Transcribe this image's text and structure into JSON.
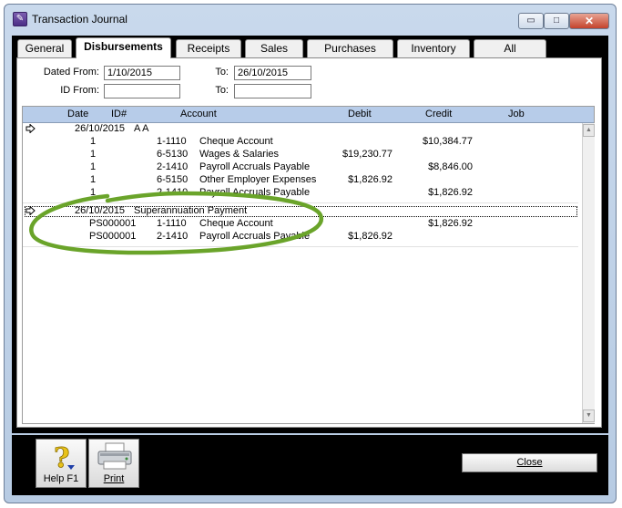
{
  "window": {
    "title": "Transaction Journal"
  },
  "titlebar_buttons": {
    "minimize": "▭",
    "maximize": "□",
    "close": "✕"
  },
  "tabs": [
    {
      "label": "General",
      "active": false
    },
    {
      "label": "Disbursements",
      "active": true
    },
    {
      "label": "Receipts",
      "active": false
    },
    {
      "label": "Sales",
      "active": false
    },
    {
      "label": "Purchases",
      "active": false
    },
    {
      "label": "Inventory",
      "active": false
    },
    {
      "label": "All",
      "active": false
    }
  ],
  "filters": {
    "dated_from_label": "Dated From:",
    "dated_from_value": "1/10/2015",
    "dated_to_label": "To:",
    "dated_to_value": "26/10/2015",
    "id_from_label": "ID From:",
    "id_from_value": "",
    "id_to_label": "To:",
    "id_to_value": ""
  },
  "grid": {
    "columns": {
      "date": "Date",
      "id": "ID#",
      "account": "Account",
      "debit": "Debit",
      "credit": "Credit",
      "job": "Job"
    },
    "transactions": [
      {
        "date": "26/10/2015",
        "memo": "A A",
        "lines": [
          {
            "id": "1",
            "acct_no": "1-1110",
            "acct_name": "Cheque Account",
            "debit": "",
            "credit": "$10,384.77"
          },
          {
            "id": "1",
            "acct_no": "6-5130",
            "acct_name": "Wages & Salaries",
            "debit": "$19,230.77",
            "credit": ""
          },
          {
            "id": "1",
            "acct_no": "2-1410",
            "acct_name": "Payroll Accruals Payable",
            "debit": "",
            "credit": "$8,846.00"
          },
          {
            "id": "1",
            "acct_no": "6-5150",
            "acct_name": "Other Employer Expenses",
            "debit": "$1,826.92",
            "credit": ""
          },
          {
            "id": "1",
            "acct_no": "2-1410",
            "acct_name": "Payroll Accruals Payable",
            "debit": "",
            "credit": "$1,826.92"
          }
        ]
      },
      {
        "date": "26/10/2015",
        "memo": "Superannuation Payment",
        "lines": [
          {
            "id": "PS000001",
            "acct_no": "1-1110",
            "acct_name": "Cheque Account",
            "debit": "",
            "credit": "$1,826.92"
          },
          {
            "id": "PS000001",
            "acct_no": "2-1410",
            "acct_name": "Payroll Accruals Payable",
            "debit": "$1,826.92",
            "credit": ""
          }
        ]
      }
    ]
  },
  "scrollbar": {
    "up": "▲",
    "down": "▼"
  },
  "toolbar": {
    "help_label": "Help F1",
    "print_label": "Print",
    "close_label": "Close"
  },
  "colors": {
    "header": "#b7cce9",
    "highlight_circle": "#6aa42a",
    "window_frame": "#b7cbe3"
  }
}
